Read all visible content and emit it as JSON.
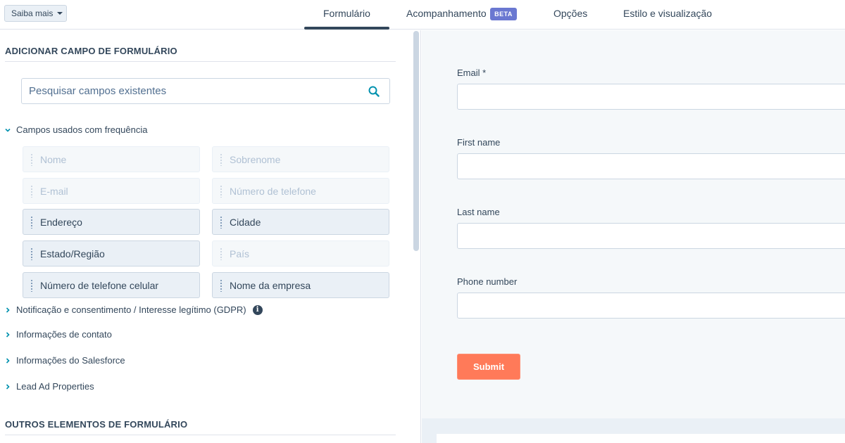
{
  "header": {
    "saiba_mais": "Saiba mais",
    "tabs": [
      {
        "label": "Formulário"
      },
      {
        "label": "Acompanhamento"
      },
      {
        "label": "Opções"
      },
      {
        "label": "Estilo e visualização"
      }
    ],
    "beta_badge": "BETA"
  },
  "sidebar": {
    "add_field_title": "ADICIONAR CAMPO DE FORMULÁRIO",
    "search_placeholder": "Pesquisar campos existentes",
    "frequent_group": "Campos usados com frequência",
    "fields": [
      {
        "label": "Nome",
        "enabled": false
      },
      {
        "label": "Sobrenome",
        "enabled": false
      },
      {
        "label": "E-mail",
        "enabled": false
      },
      {
        "label": "Número de telefone",
        "enabled": false
      },
      {
        "label": "Endereço",
        "enabled": true
      },
      {
        "label": "Cidade",
        "enabled": true
      },
      {
        "label": "Estado/Região",
        "enabled": true
      },
      {
        "label": "País",
        "enabled": false
      },
      {
        "label": "Número de telefone celular",
        "enabled": true
      },
      {
        "label": "Nome da empresa",
        "enabled": true
      }
    ],
    "groups": [
      {
        "label": "Notificação e consentimento / Interesse legítimo (GDPR)"
      },
      {
        "label": "Informações de contato"
      },
      {
        "label": "Informações do Salesforce"
      },
      {
        "label": "Lead Ad Properties"
      }
    ],
    "other_elements_title": "OUTROS ELEMENTOS DE FORMULÁRIO"
  },
  "preview": {
    "fields": [
      {
        "label": "Email *",
        "value": ""
      },
      {
        "label": "First name",
        "value": ""
      },
      {
        "label": "Last name",
        "value": ""
      },
      {
        "label": "Phone number",
        "value": ""
      }
    ],
    "submit_label": "Submit"
  },
  "colors": {
    "accent": "#33475b",
    "submit": "#ff7a59",
    "beta": "#6a78d1",
    "search_icon": "#0091ae"
  }
}
